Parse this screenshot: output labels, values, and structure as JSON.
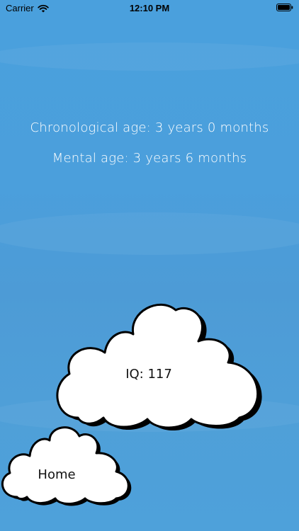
{
  "status_bar": {
    "carrier": "Carrier",
    "time": "12:10 PM",
    "wifi_icon": "wifi-icon",
    "battery_icon": "battery-icon"
  },
  "results": {
    "chronological_age": "Chronological age: 3 years 0 months",
    "mental_age": "Mental age: 3 years 6 months",
    "iq": "IQ: 117"
  },
  "navigation": {
    "home_label": "Home"
  },
  "colors": {
    "sky": "#4b9fdc",
    "cloud_fill": "#ffffff",
    "cloud_outline": "#000000",
    "text_light": "#ffffff"
  }
}
